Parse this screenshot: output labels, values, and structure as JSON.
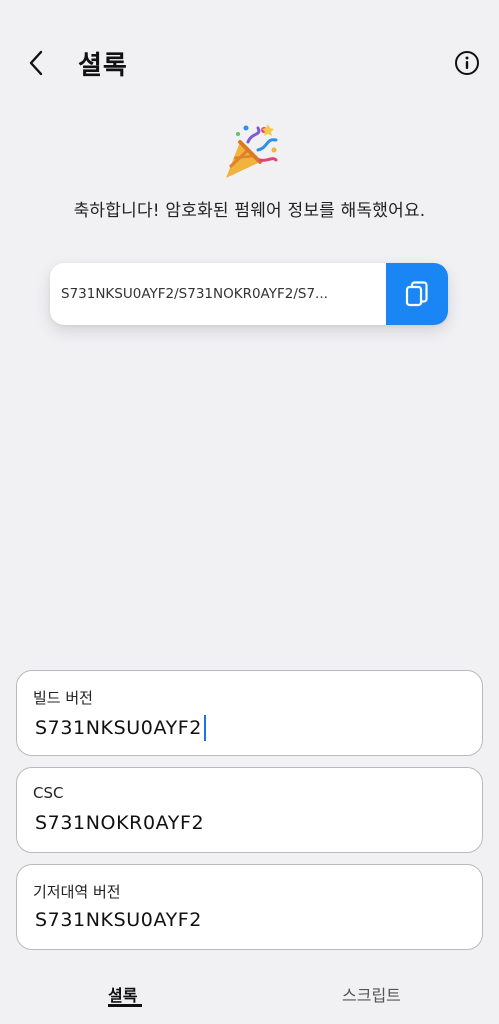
{
  "header": {
    "title": "셜록",
    "back_icon": "chevron-left-icon",
    "info_icon": "info-circle-icon"
  },
  "celebration": {
    "icon": "party-popper-icon",
    "message": "축하합니다! 암호화된 펌웨어 정보를 해독했어요."
  },
  "result": {
    "value": "S731NKSU0AYF2/S731NOKR0AYF2/S7...",
    "copy_icon": "copy-icon",
    "accent": "#1a86f5"
  },
  "fields": [
    {
      "label": "빌드 버전",
      "value": "S731NKSU0AYF2"
    },
    {
      "label": "CSC",
      "value": "S731NOKR0AYF2"
    },
    {
      "label": "기저대역 버전",
      "value": "S731NKSU0AYF2"
    }
  ],
  "tabs": [
    {
      "label": "셜록",
      "active": true
    },
    {
      "label": "스크립트",
      "active": false
    }
  ]
}
